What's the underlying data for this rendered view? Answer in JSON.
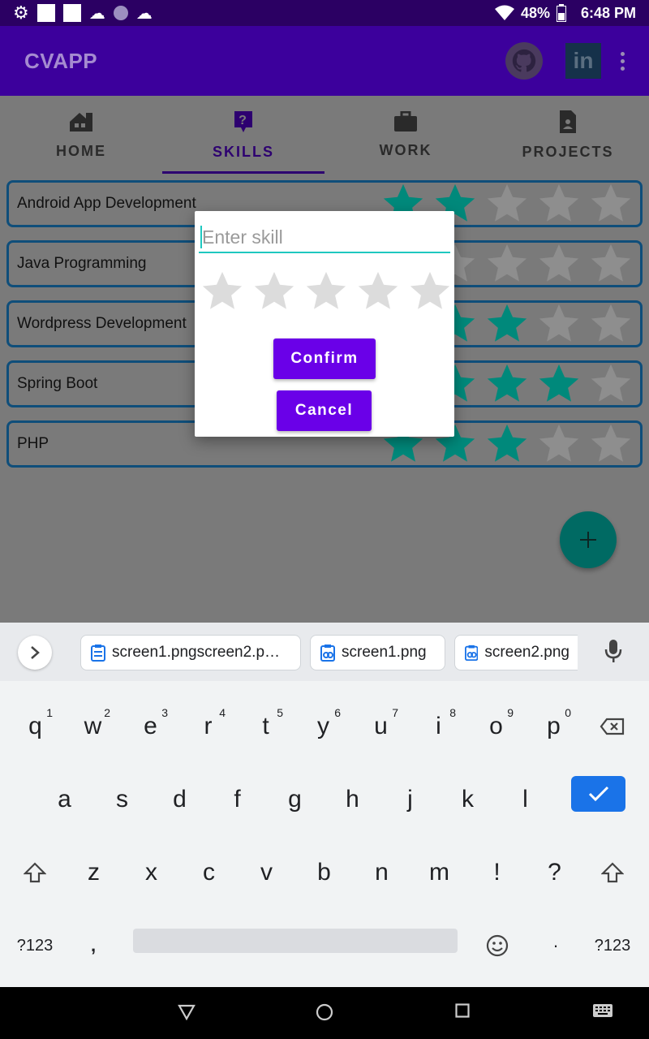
{
  "status": {
    "battery": "48%",
    "time": "6:48 PM"
  },
  "app": {
    "title": "CVAPP",
    "linkedin": "in"
  },
  "tabs": [
    {
      "label": "HOME"
    },
    {
      "label": "SKILLS"
    },
    {
      "label": "WORK"
    },
    {
      "label": "PROJECTS"
    }
  ],
  "skills": [
    {
      "name": "Android App Development",
      "rating": 2
    },
    {
      "name": "Java Programming",
      "rating": 1
    },
    {
      "name": "Wordpress Development",
      "rating": 3
    },
    {
      "name": "Spring Boot",
      "rating": 4
    },
    {
      "name": "PHP",
      "rating": 3
    }
  ],
  "dialog": {
    "placeholder": "Enter skill",
    "rating": 0,
    "confirm": "Confirm",
    "cancel": "Cancel"
  },
  "colors": {
    "star_filled": "#00897b",
    "star_empty": "#8e8e8e",
    "accent": "#6200ee"
  },
  "keyboard": {
    "suggestions": [
      "screen1.pngscreen2.p…",
      "screen1.png",
      "screen2.png"
    ],
    "row1": [
      {
        "k": "q",
        "h": "1"
      },
      {
        "k": "w",
        "h": "2"
      },
      {
        "k": "e",
        "h": "3"
      },
      {
        "k": "r",
        "h": "4"
      },
      {
        "k": "t",
        "h": "5"
      },
      {
        "k": "y",
        "h": "6"
      },
      {
        "k": "u",
        "h": "7"
      },
      {
        "k": "i",
        "h": "8"
      },
      {
        "k": "o",
        "h": "9"
      },
      {
        "k": "p",
        "h": "0"
      }
    ],
    "row2": [
      "a",
      "s",
      "d",
      "f",
      "g",
      "h",
      "j",
      "k",
      "l"
    ],
    "row3": [
      "z",
      "x",
      "c",
      "v",
      "b",
      "n",
      "m",
      "!",
      "?"
    ],
    "sym": "?123",
    "comma": ",",
    "period": "·"
  }
}
